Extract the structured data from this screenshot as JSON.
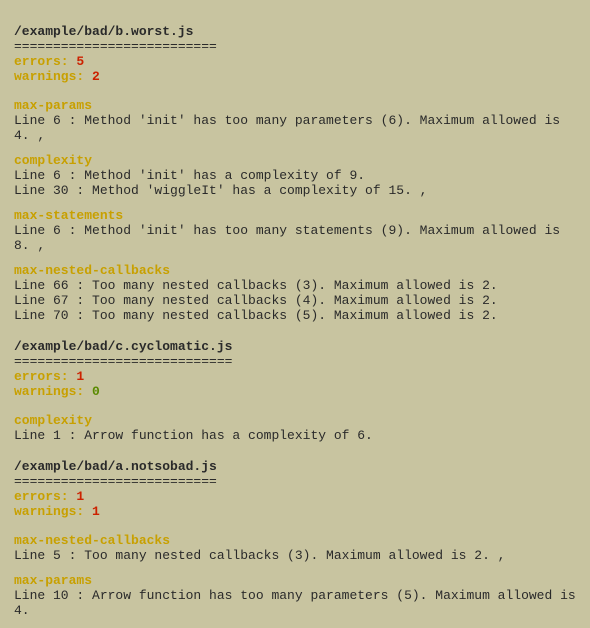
{
  "sections": [
    {
      "filepath": "/example/bad/b.worst.js",
      "separator": "==========================",
      "errors": 5,
      "warnings": 2,
      "rules": [
        {
          "name": "max-params",
          "messages": [
            "Line 6 : Method 'init' has too many parameters (6). Maximum allowed is 4. ,",
            "complexity"
          ],
          "extra_messages": [
            "Line 6 : Method 'init' has a complexity of 9.",
            "Line 30 : Method 'wiggleIt' has a complexity of 15. ,"
          ],
          "extra_rule": "max-statements",
          "extra_rule_messages": [
            "Line 6 : Method 'init' has too many statements (9). Maximum allowed is 8. ,"
          ],
          "extra_rule2": "max-nested-callbacks",
          "extra_rule2_messages": [
            "Line 66 : Too many nested callbacks (3). Maximum allowed is 2.",
            "Line 67 : Too many nested callbacks (4). Maximum allowed is 2.",
            "Line 70 : Too many nested callbacks (5). Maximum allowed is 2."
          ]
        }
      ]
    },
    {
      "filepath": "/example/bad/c.cyclomatic.js",
      "separator": "============================",
      "errors": 1,
      "warnings": 0,
      "rules": [
        {
          "name": "complexity",
          "messages": [
            "Line 1 : Arrow function has a complexity of 6."
          ]
        }
      ]
    },
    {
      "filepath": "/example/bad/a.notsobad.js",
      "separator": "==========================",
      "errors": 1,
      "warnings": 1,
      "rules": [
        {
          "name": "max-nested-callbacks",
          "messages": [
            "Line 5 : Too many nested callbacks (3). Maximum allowed is 2. ,"
          ],
          "extra_rule": "max-params",
          "extra_rule_messages": [
            "Line 10 : Arrow function has too many parameters (5). Maximum allowed is 4."
          ]
        }
      ]
    }
  ]
}
